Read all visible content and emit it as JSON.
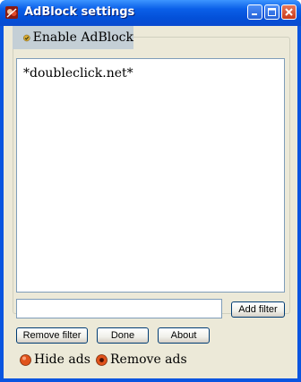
{
  "window": {
    "title": "AdBlock settings"
  },
  "enable_checkbox": {
    "label": "Enable AdBlock",
    "checked": true
  },
  "filters": [
    "*doubleclick.net*"
  ],
  "filter_input": {
    "value": "",
    "placeholder": ""
  },
  "buttons": {
    "add_filter": "Add filter",
    "remove_filter": "Remove filter",
    "done": "Done",
    "about": "About"
  },
  "mode": {
    "options": [
      "Hide ads",
      "Remove ads"
    ],
    "selected": "Remove ads"
  },
  "colors": {
    "titlebar": "#0a5fe8",
    "client": "#ece9d8",
    "accent_radio": "#e0521b"
  }
}
